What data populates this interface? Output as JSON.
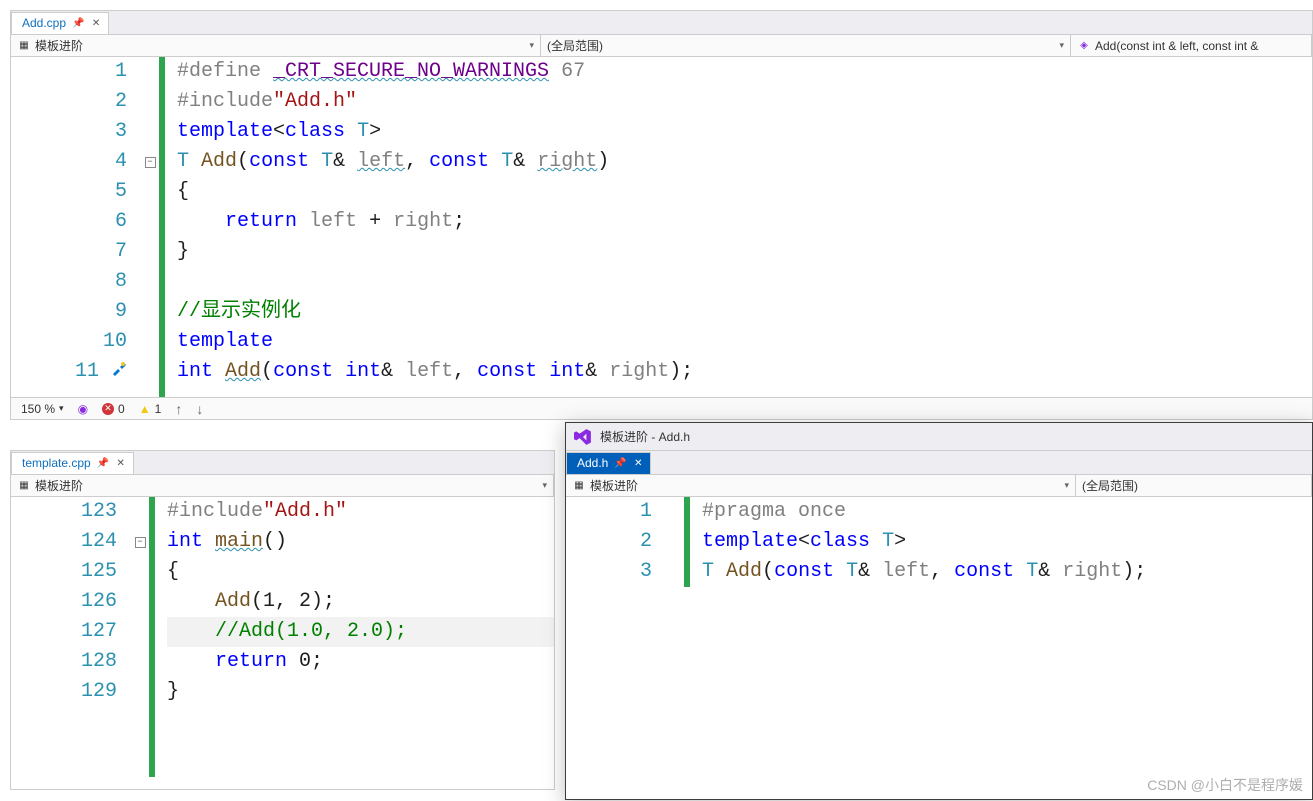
{
  "top": {
    "tab": "Add.cpp",
    "nav1": "模板进阶",
    "nav2": "(全局范围)",
    "nav3": "Add(const int & left, const int &",
    "zoom": "150 %",
    "errors": "0",
    "warnings": "1",
    "lines": [
      {
        "n": "1",
        "html": "<span class='pp'>#define </span><span class='wavy' style='color:#6f008a'>_CRT_SECURE_NO_WARNINGS</span><span class='pp'> 67</span>"
      },
      {
        "n": "2",
        "html": "<span class='pp'>#include</span><span class='str'>\"Add.h\"</span>"
      },
      {
        "n": "3",
        "html": "<span class='kw'>template</span>&lt;<span class='kw'>class</span> <span class='ident'>T</span>&gt;"
      },
      {
        "n": "4",
        "fold": "-",
        "html": "<span class='ident'>T</span> <span style='color:#745320'>Add</span>(<span class='kw'>const</span> <span class='ident'>T</span>&amp; <span class='wavy' style='color:#808080'>left</span>, <span class='kw'>const</span> <span class='ident'>T</span>&amp; <span class='wavy' style='color:#808080'>right</span>)"
      },
      {
        "n": "5",
        "html": "{"
      },
      {
        "n": "6",
        "html": "    <span class='kw'>return</span> <span style='color:#808080'>left</span> + <span style='color:#808080'>right</span>;"
      },
      {
        "n": "7",
        "html": "}"
      },
      {
        "n": "8",
        "html": ""
      },
      {
        "n": "9",
        "html": "<span class='cmt'>//显示实例化</span>"
      },
      {
        "n": "10",
        "html": "<span class='kw'>template</span>"
      },
      {
        "n": "11",
        "icon": "screwdriver",
        "html": "<span class='kw'>int</span> <span class='wavy' style='color:#745320'>Add</span>(<span class='kw'>const</span> <span class='kw'>int</span>&amp; <span style='color:#808080'>left</span>, <span class='kw'>const</span> <span class='kw'>int</span>&amp; <span style='color:#808080'>right</span>);"
      }
    ]
  },
  "bottomLeft": {
    "tab": "template.cpp",
    "nav1": "模板进阶",
    "lines": [
      {
        "n": "123",
        "html": "<span class='pp'>#include</span><span class='str'>\"Add.h\"</span>"
      },
      {
        "n": "124",
        "fold": "-",
        "html": "<span class='kw'>int</span> <span class='wavy' style='color:#745320'>main</span>()"
      },
      {
        "n": "125",
        "html": "{"
      },
      {
        "n": "126",
        "html": "    <span style='color:#745320'>Add</span>(1, 2);"
      },
      {
        "n": "127",
        "hl": true,
        "html": "    <span class='cmt'>//Add(1.0, 2.0);</span>"
      },
      {
        "n": "128",
        "html": "    <span class='kw'>return</span> 0;"
      },
      {
        "n": "129",
        "html": "}"
      }
    ]
  },
  "float": {
    "title": "模板进阶 - Add.h",
    "tab": "Add.h",
    "nav1": "模板进阶",
    "nav2": "(全局范围)",
    "lines": [
      {
        "n": "1",
        "html": "<span class='pp'>#pragma once</span>"
      },
      {
        "n": "2",
        "html": "<span class='kw'>template</span>&lt;<span class='kw'>class</span> <span class='ident'>T</span>&gt;"
      },
      {
        "n": "3",
        "html": "<span class='ident'>T</span> <span style='color:#745320'>Add</span>(<span class='kw'>const</span> <span class='ident'>T</span>&amp; <span style='color:#808080'>left</span>, <span class='kw'>const</span> <span class='ident'>T</span>&amp; <span style='color:#808080'>right</span>);"
      }
    ]
  },
  "watermark": "CSDN @小白不是程序媛"
}
